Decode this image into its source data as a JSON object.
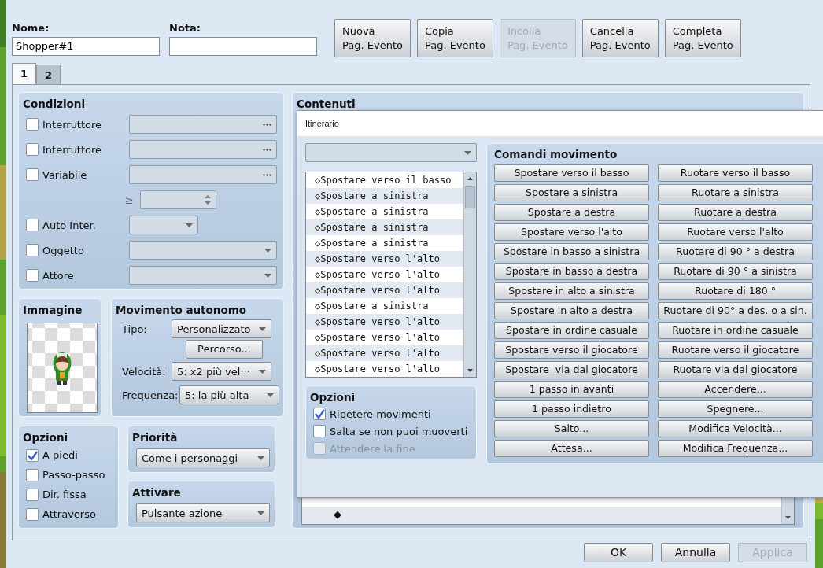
{
  "name_field": {
    "label": "Nome:",
    "value": "Shopper#1"
  },
  "note_field": {
    "label": "Nota:"
  },
  "page_buttons": [
    {
      "lines": [
        "Nuova",
        "Pag. Evento"
      ],
      "disabled": false
    },
    {
      "lines": [
        "Copia",
        "Pag. Evento"
      ],
      "disabled": false
    },
    {
      "lines": [
        "Incolla",
        "Pag. Evento"
      ],
      "disabled": true
    },
    {
      "lines": [
        "Cancella",
        "Pag. Evento"
      ],
      "disabled": false
    },
    {
      "lines": [
        "Completa",
        "Pag. Evento"
      ],
      "disabled": false
    }
  ],
  "tabs": [
    {
      "label": "1",
      "selected": true
    },
    {
      "label": "2",
      "selected": false
    }
  ],
  "conditions": {
    "title": "Condizioni",
    "rows": [
      {
        "kind": "picker",
        "label": "Interruttore",
        "checked": false
      },
      {
        "kind": "picker",
        "label": "Interruttore",
        "checked": false
      },
      {
        "kind": "picker",
        "label": "Variabile",
        "checked": false
      },
      {
        "kind": "spin",
        "symbol": "≥"
      },
      {
        "kind": "short_combo",
        "label": "Auto Inter.",
        "checked": false
      },
      {
        "kind": "combo",
        "label": "Oggetto",
        "checked": false
      },
      {
        "kind": "combo",
        "label": "Attore",
        "checked": false
      }
    ]
  },
  "image": {
    "title": "Immagine"
  },
  "autonomous": {
    "title": "Movimento autonomo",
    "type_label": "Tipo:",
    "type_value": "Personalizzato",
    "route_button": "Percorso...",
    "speed_label": "Velocità:",
    "speed_value": "5: x2 più vel···",
    "frequency_label": "Frequenza:",
    "frequency_value": "5: la più alta"
  },
  "options": {
    "title": "Opzioni",
    "items": [
      {
        "label": "A piedi",
        "checked": true
      },
      {
        "label": "Passo-passo",
        "checked": false
      },
      {
        "label": "Dir. fissa",
        "checked": false
      },
      {
        "label": "Attraverso",
        "checked": false
      }
    ]
  },
  "priority": {
    "title": "Priorità",
    "value": "Come i personaggi"
  },
  "trigger": {
    "title": "Attivare",
    "value": "Pulsante azione"
  },
  "contents": {
    "title": "Contenuti",
    "end_marker": "◆"
  },
  "route_dialog": {
    "title": "Itinerario",
    "list": [
      "◇Spostare verso il basso",
      "◇Spostare a sinistra",
      "◇Spostare a sinistra",
      "◇Spostare a sinistra",
      "◇Spostare a sinistra",
      "◇Spostare verso l'alto",
      "◇Spostare verso l'alto",
      "◇Spostare verso l'alto",
      "◇Spostare a sinistra",
      "◇Spostare verso l'alto",
      "◇Spostare verso l'alto",
      "◇Spostare verso l'alto",
      "◇Spostare verso l'alto"
    ],
    "options": {
      "title": "Opzioni",
      "items": [
        {
          "label": "Ripetere movimenti",
          "checked": true,
          "disabled": false
        },
        {
          "label": "Salta se non puoi muoverti",
          "checked": false,
          "disabled": false
        },
        {
          "label": "Attendere la fine",
          "checked": false,
          "disabled": true
        }
      ]
    },
    "commands": {
      "title": "Comandi movimento",
      "rows": [
        [
          "Spostare verso il basso",
          "Ruotare verso il basso"
        ],
        [
          "Spostare a sinistra",
          "Ruotare a sinistra"
        ],
        [
          "Spostare a destra",
          "Ruotare a destra"
        ],
        [
          "Spostare verso l'alto",
          "Ruotare verso l'alto"
        ],
        [
          "Spostare in basso a sinistra",
          "Ruotare di 90 ° a destra"
        ],
        [
          "Spostare in basso a destra",
          "Ruotare di 90 ° a sinistra"
        ],
        [
          "Spostare in alto a sinistra",
          "Ruotare di 180 °"
        ],
        [
          "Spostare in alto a destra",
          "Ruotare di 90° a des. o a sin."
        ],
        [
          "Spostare in ordine casuale",
          "Ruotare in ordine casuale"
        ],
        [
          "Spostare verso il giocatore",
          "Ruotare verso il giocatore"
        ],
        [
          "Spostare  via dal giocatore",
          "Ruotare via dal giocatore"
        ],
        [
          "1 passo in avanti",
          "Accendere..."
        ],
        [
          "1 passo indietro",
          "Spegnere..."
        ],
        [
          "Salto...",
          "Modifica Velocità..."
        ],
        [
          "Attesa...",
          "Modifica Frequenza..."
        ]
      ]
    }
  },
  "footer_buttons": [
    {
      "label": "OK",
      "disabled": false
    },
    {
      "label": "Annulla",
      "disabled": false
    },
    {
      "label": "Applica",
      "disabled": true
    }
  ]
}
